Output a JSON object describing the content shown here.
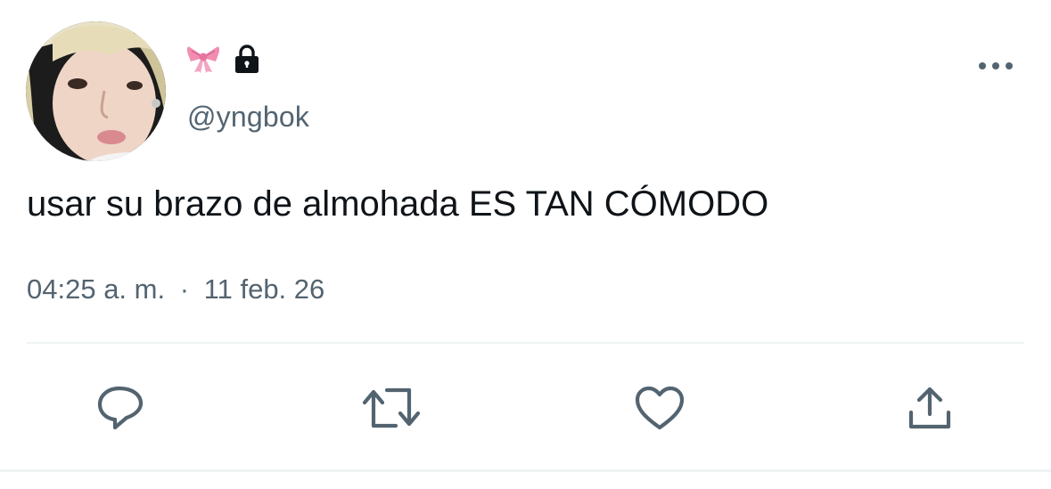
{
  "user": {
    "avatar_alt": "",
    "badges": [
      "ribbon-emoji",
      "lock-icon"
    ],
    "handle": "@yngbok"
  },
  "tweet": {
    "text": "usar su brazo de almohada ES TAN CÓMODO",
    "time": "04:25 a. m.",
    "separator": "·",
    "date": "11 feb. 26"
  },
  "actions": [
    "reply-icon",
    "retweet-icon",
    "like-icon",
    "share-icon"
  ],
  "colors": {
    "text": "#0f1419",
    "secondary": "#536471",
    "divider": "#eff3f4",
    "ribbon": "#f08bb0"
  }
}
